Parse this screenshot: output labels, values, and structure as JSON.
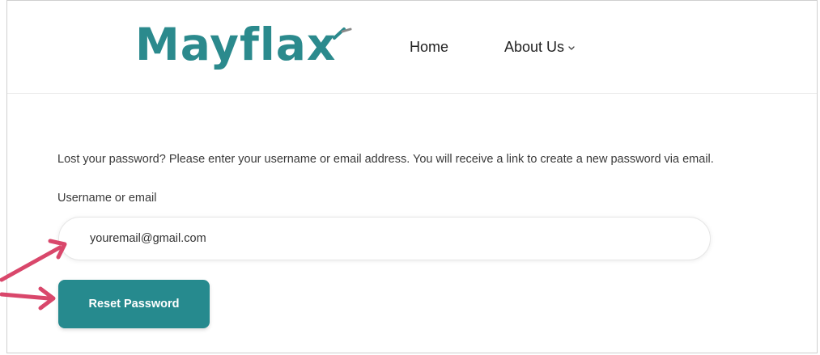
{
  "header": {
    "logo_text": "Mayflax",
    "nav": {
      "home_label": "Home",
      "about_label": "About Us"
    }
  },
  "main": {
    "intro_text": "Lost your password? Please enter your username or email address. You will receive a link to create a new password via email.",
    "field_label": "Username or email",
    "input_value": "youremail@gmail.com",
    "submit_label": "Reset Password"
  },
  "colors": {
    "brand_teal": "#2b8a8d",
    "button_teal": "#268a8e",
    "arrow_red": "#d9476b"
  },
  "icons": {
    "about_dropdown": "chevron-down-icon",
    "annotations": "arrow-icon"
  }
}
